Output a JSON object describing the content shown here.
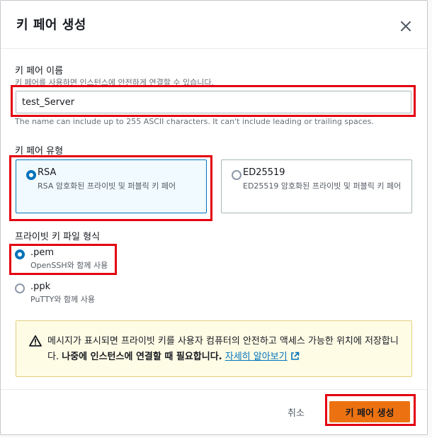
{
  "modal": {
    "title": "키 페어 생성",
    "close_icon": "close-icon"
  },
  "key_name": {
    "label": "키 페어 이름",
    "description": "키 페어를 사용하면 인스턴스에 안전하게 연결할 수 있습니다.",
    "value": "test_Server",
    "constraint": "The name can include up to 255 ASCII characters. It can't include leading or trailing spaces."
  },
  "key_type": {
    "label": "키 페어 유형",
    "options": [
      {
        "title": "RSA",
        "description": "RSA 암호화된 프라이빗 및 퍼블릭 키 페어",
        "selected": true
      },
      {
        "title": "ED25519",
        "description": "ED25519 암호화된 프라이빗 및 퍼블릭 키 페어",
        "selected": false
      }
    ]
  },
  "file_format": {
    "label": "프라이빗 키 파일 형식",
    "options": [
      {
        "title": ".pem",
        "description": "OpenSSH와 함께 사용",
        "selected": true
      },
      {
        "title": ".ppk",
        "description": "PuTTY와 함께 사용",
        "selected": false
      }
    ]
  },
  "alert": {
    "icon": "warning-icon",
    "text": "메시지가 표시되면 프라이빗 키를 사용자 컴퓨터의 안전하고 액세스 가능한 위치에 저장합니다. ",
    "bold_text": "나중에 인스턴스에 연결할 때 필요합니다.",
    "link_text": "자세히 알아보기",
    "link_icon": "external-link-icon"
  },
  "footer": {
    "cancel_label": "취소",
    "create_label": "키 페어 생성"
  },
  "colors": {
    "primary": "#ec7211",
    "selected_blue": "#0073bb",
    "highlight_red": "#e3000f",
    "alert_bg": "#fffce6"
  }
}
